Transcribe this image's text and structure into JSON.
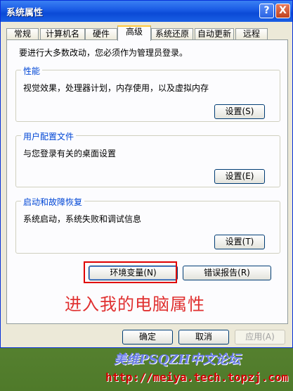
{
  "window": {
    "title": "系统属性",
    "help_glyph": "?",
    "close_glyph": "X"
  },
  "tabs": [
    {
      "label": "常规"
    },
    {
      "label": "计算机名"
    },
    {
      "label": "硬件"
    },
    {
      "label": "高级",
      "active": true
    },
    {
      "label": "系统还原"
    },
    {
      "label": "自动更新"
    },
    {
      "label": "远程"
    }
  ],
  "notice": "要进行大多数改动，您必须作为管理员登录。",
  "groups": {
    "performance": {
      "title": "性能",
      "desc": "视觉效果，处理器计划，内存使用，以及虚拟内存",
      "button": "设置(S)"
    },
    "user_profiles": {
      "title": "用户配置文件",
      "desc": "与您登录有关的桌面设置",
      "button": "设置(E)"
    },
    "startup_recovery": {
      "title": "启动和故障恢复",
      "desc": "系统启动，系统失败和调试信息",
      "button": "设置(T)"
    }
  },
  "env_button": "环境变量(N)",
  "error_report_button": "错误报告(R)",
  "footer": {
    "ok": "确定",
    "cancel": "取消",
    "apply": "应用(A)"
  },
  "annotation": "进入我的电脑属性",
  "watermark": {
    "brand": "美维PSQZH中文论坛",
    "url": "http://meiya.tech.topzj.com"
  }
}
